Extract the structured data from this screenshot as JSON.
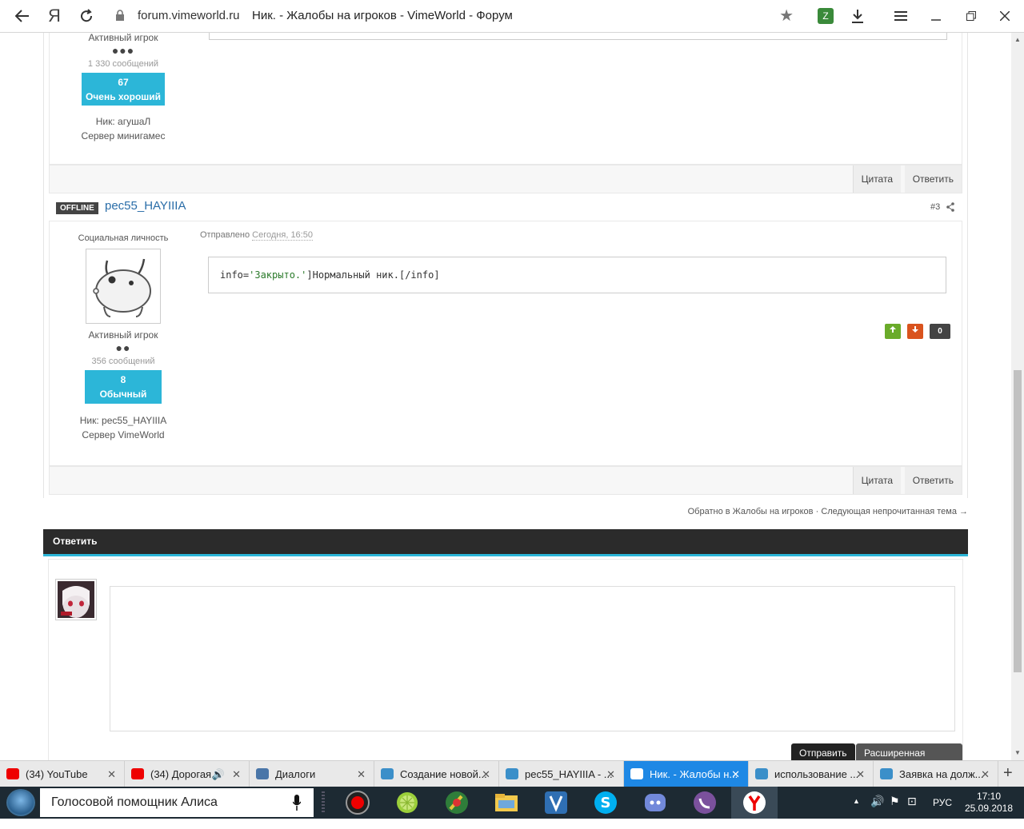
{
  "browser": {
    "domain": "forum.vimeworld.ru",
    "title": "Ник. - Жалобы на игроков - VimeWorld - Форум",
    "yandex_letter": "Я"
  },
  "post1": {
    "rank": "Активный игрок",
    "dots": "●●●",
    "messages": "1 330 сообщений",
    "rep_value": "67",
    "rep_label": "Очень хороший",
    "nick": "Ник: агушаЛ",
    "server": "Сервер минигамес",
    "quote_btn": "Цитата",
    "reply_btn": "Ответить"
  },
  "post2": {
    "status": "OFFLINE",
    "author": "pec55_HAYIIIA",
    "post_number": "#3",
    "title": "Социальная личность",
    "sent_prefix": "Отправлено",
    "sent_time": "Сегодня, 16:50",
    "code_key": "info=",
    "code_string": "'Закрыто.'",
    "code_text": "]Нормальный ник.[",
    "code_close": "/info",
    "code_end": "]",
    "rank": "Активный игрок",
    "dots": "●●",
    "messages": "356 сообщений",
    "rep_value": "8",
    "rep_label": "Обычный",
    "nick": "Ник: pec55_HAYIIIA",
    "server": "Сервер VimeWorld",
    "vote_score": "0",
    "quote_btn": "Цитата",
    "reply_btn": "Ответить"
  },
  "nav": {
    "back_link": "Обратно в Жалобы на игроков",
    "sep": "·",
    "next_link": "Следующая непрочитанная тема →"
  },
  "reply": {
    "header": "Ответить",
    "send_btn": "Отправить",
    "extended_btn": "Расширенная форма"
  },
  "tabs": [
    {
      "label": "(34) YouTube",
      "icon": "youtube-icon"
    },
    {
      "label": "(34) Дорогая...",
      "icon": "youtube-icon"
    },
    {
      "label": "Диалоги",
      "icon": "chat-icon"
    },
    {
      "label": "Создание новой...",
      "icon": "vimeworld-icon"
    },
    {
      "label": "pec55_HAYIIIA - ...",
      "icon": "vimeworld-icon"
    },
    {
      "label": "Ник. - Жалобы н...",
      "icon": "vimeworld-icon"
    },
    {
      "label": "использование ...",
      "icon": "vimeworld-icon"
    },
    {
      "label": "Заявка на долж...",
      "icon": "vimeworld-icon"
    }
  ],
  "taskbar": {
    "assistant": "Голосовой помощник Алиса",
    "lang": "РУС",
    "time": "17:10",
    "date": "25.09.2018"
  },
  "colors": {
    "accent": "#2cb6d8",
    "link": "#2a6da8",
    "active_tab": "#1e88e5"
  }
}
